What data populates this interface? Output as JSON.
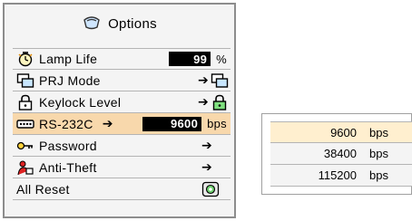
{
  "title": "Options",
  "menu": {
    "lamp_life": {
      "label": "Lamp Life",
      "value": "99",
      "unit": "%"
    },
    "prj_mode": {
      "label": "PRJ Mode"
    },
    "keylock": {
      "label": "Keylock Level"
    },
    "rs232c": {
      "label": "RS-232C",
      "value": "9600",
      "unit": "bps"
    },
    "password": {
      "label": "Password"
    },
    "anti_theft": {
      "label": "Anti-Theft"
    },
    "all_reset": {
      "label": "All Reset"
    }
  },
  "submenu": [
    {
      "value": "9600",
      "unit": "bps",
      "selected": true
    },
    {
      "value": "38400",
      "unit": "bps",
      "selected": false
    },
    {
      "value": "115200",
      "unit": "bps",
      "selected": false
    }
  ],
  "colors": {
    "selected_row": "#f8d8ac",
    "selected_sub_row": "#ffefcf",
    "panel_bg": "#f4f4f4"
  }
}
